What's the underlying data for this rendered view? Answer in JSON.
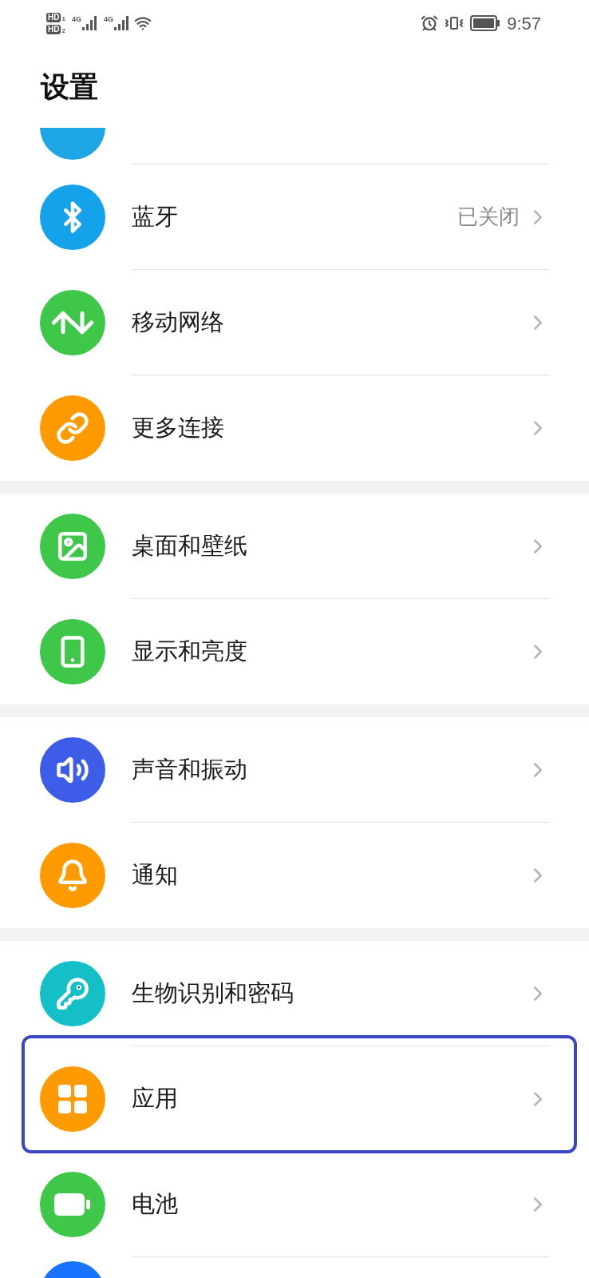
{
  "status_bar": {
    "sims": [
      {
        "badge": "HD",
        "slot": "1",
        "network": "4G"
      },
      {
        "badge": "HD",
        "slot": "2",
        "network": "4G"
      }
    ],
    "time": "9:57"
  },
  "title": "设置",
  "groups": [
    {
      "items": [
        {
          "kind": "partial_top",
          "color": "#1ea5e3"
        },
        {
          "kind": "row",
          "label": "蓝牙",
          "value": "已关闭",
          "color": "#14a3ea",
          "highlighted": false
        },
        {
          "kind": "row",
          "label": "移动网络",
          "color": "#3fc74a",
          "highlighted": false
        },
        {
          "kind": "row",
          "label": "更多连接",
          "color": "#ff9a00",
          "highlighted": false
        }
      ]
    },
    {
      "items": [
        {
          "kind": "row",
          "label": "桌面和壁纸",
          "color": "#3fc74a",
          "highlighted": false
        },
        {
          "kind": "row",
          "label": "显示和亮度",
          "color": "#3fc74a",
          "highlighted": false
        }
      ]
    },
    {
      "items": [
        {
          "kind": "row",
          "label": "声音和振动",
          "color": "#3d5de8",
          "highlighted": false
        },
        {
          "kind": "row",
          "label": "通知",
          "color": "#ff9a00",
          "highlighted": false
        }
      ]
    },
    {
      "items": [
        {
          "kind": "row",
          "label": "生物识别和密码",
          "color": "#14bfc8",
          "highlighted": false
        },
        {
          "kind": "row",
          "label": "应用",
          "color": "#ff9a00",
          "highlighted": true
        },
        {
          "kind": "row",
          "label": "电池",
          "color": "#3fc74a",
          "highlighted": false
        },
        {
          "kind": "partial_bottom",
          "color": "#1a73ff"
        }
      ]
    }
  ]
}
